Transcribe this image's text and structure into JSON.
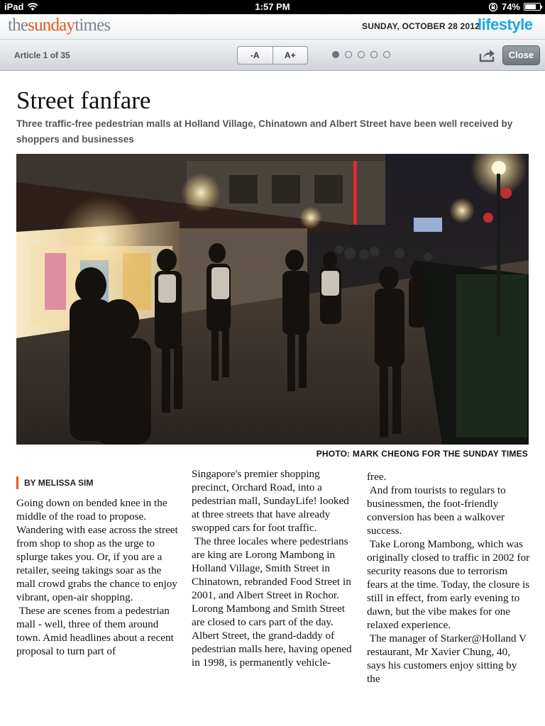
{
  "status_bar": {
    "device": "iPad",
    "time": "1:57 PM",
    "battery": "74%",
    "battery_level": 0.74
  },
  "masthead": {
    "logo": {
      "part1": "the",
      "part2": "sunday",
      "part3": "times"
    },
    "date": "SUNDAY, OCTOBER 28 2012",
    "section": "lifestyle",
    "colors": {
      "logo_accent": "#e05a1f",
      "section": "#1aa6e6"
    }
  },
  "toolbar": {
    "article_position": "Article 1 of 35",
    "font_decrease": "-A",
    "font_increase": "A+",
    "page_count": 5,
    "active_page": 1,
    "close_label": "Close"
  },
  "article": {
    "headline": "Street fanfare",
    "standfirst": "Three traffic-free pedestrian malls at Holland Village, Chinatown and Albert Street have been well received by shoppers and businesses",
    "photo_credit": "PHOTO: MARK CHEONG FOR THE SUNDAY TIMES",
    "byline": "BY MELISSA SIM",
    "col1": {
      "p1": "Going down on bended knee in the middle of the road to propose. Wandering with ease across the street from shop to shop as the urge to splurge takes you. Or, if you are a retailer, seeing takings soar as the mall crowd grabs the chance to enjoy vibrant, open-air shopping.",
      "p2": "These are scenes from a pedestrian mall - well, three of them around town. Amid headlines about a recent proposal to turn part of"
    },
    "col2": {
      "p1": "Singapore's premier shopping precinct, Orchard Road, into a pedestrian mall, SundayLife! looked at three streets that have already swopped cars for foot traffic.",
      "p2": "The three locales where pedestrians are king are Lorong Mambong in Holland Village, Smith Street in Chinatown, rebranded Food Street in 2001, and Albert Street in Rochor. Lorong Mambong and Smith Street are closed to cars part of the day. Albert Street, the grand-daddy of pedestrian malls here, having opened in 1998, is permanently vehicle-"
    },
    "col3": {
      "p1": "free.",
      "p2": "And from tourists to regulars to businessmen, the foot-friendly conversion has been a walkover success.",
      "p3": "Take Lorong Mambong, which was originally closed to traffic in 2002 for security reasons due to terrorism fears at the time. Today, the closure is still in effect, from early evening to dawn, but the vibe makes for one relaxed experience.",
      "p4": "The manager of Starker@Holland V restaurant, Mr Xavier Chung, 40, says his customers enjoy sitting by the"
    }
  }
}
